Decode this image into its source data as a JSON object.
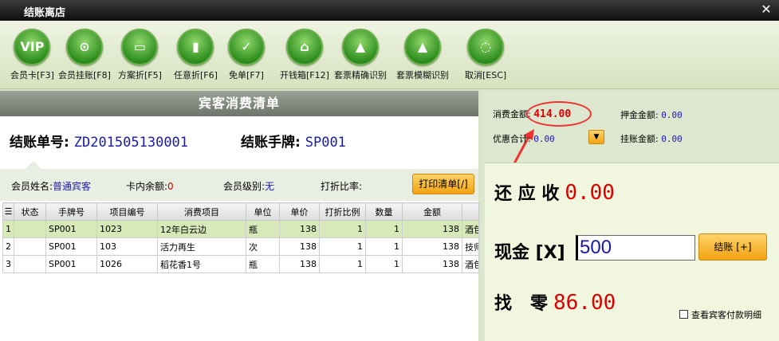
{
  "window": {
    "title": "结账离店"
  },
  "toolbar": [
    {
      "label": "会员卡[F3]",
      "icon": "VIP",
      "name": "vip-card"
    },
    {
      "label": "会员挂账[F8]",
      "icon": "⊙",
      "name": "member-charge"
    },
    {
      "label": "方案折[F5]",
      "icon": "▭",
      "name": "plan-discount"
    },
    {
      "label": "任意折[F6]",
      "icon": "▮",
      "name": "any-discount"
    },
    {
      "label": "免单[F7]",
      "icon": "✓",
      "name": "free-order"
    },
    {
      "label": "开钱箱[F12]",
      "icon": "⌂",
      "name": "open-cashbox"
    },
    {
      "label": "套票精确识别",
      "icon": "▲",
      "name": "ticket-exact"
    },
    {
      "label": "套票模糊识别",
      "icon": "▲",
      "name": "ticket-fuzzy"
    },
    {
      "label": "取消[ESC]",
      "icon": "◌",
      "name": "cancel"
    }
  ],
  "list": {
    "header": "宾客消费清单",
    "bill_no_label": "结账单号:",
    "bill_no": "ZD201505130001",
    "tag_label": "结账手牌:",
    "tag": "SP001",
    "guest_name_label": "会员姓名:",
    "guest_name": "普通宾客",
    "card_balance_label": "卡内余额:",
    "card_balance": "0",
    "level_label": "会员级别:",
    "level": "无",
    "discount_label": "打折比率:",
    "discount": "",
    "print_button": "打印清单[/]",
    "columns": [
      "☰",
      "状态",
      "手牌号",
      "项目编号",
      "消费项目",
      "单位",
      "单价",
      "打折比例",
      "数量",
      "金额",
      ""
    ],
    "rows": [
      [
        "1",
        "",
        "SP001",
        "1023",
        "12年白云边",
        "瓶",
        "138",
        "1",
        "1",
        "138",
        "酒包"
      ],
      [
        "2",
        "",
        "SP001",
        "103",
        "活力再生",
        "次",
        "138",
        "1",
        "1",
        "138",
        "技师"
      ],
      [
        "3",
        "",
        "SP001",
        "1026",
        "稻花香1号",
        "瓶",
        "138",
        "1",
        "1",
        "138",
        "酒包"
      ]
    ]
  },
  "summary": {
    "consume_label": "消费金额:",
    "consume": "414.00",
    "deposit_label": "押金金额:",
    "deposit": "0.00",
    "discount_total_label": "优惠合计:",
    "discount_total": "0.00",
    "credit_label": "挂账金额:",
    "credit": "0.00"
  },
  "payment": {
    "due_label": "还 应 收",
    "due": "0.00",
    "cash_label": "现金 [X]",
    "cash_value": "500",
    "pay_button": "结账 [+]",
    "change_label": "找   零",
    "change": "86.00",
    "detail_checkbox": "查看宾客付款明细"
  },
  "colors": {
    "accent_red": "#dd0000",
    "value_blue": "#1a1aa8",
    "button_orange": "#f3a312"
  }
}
